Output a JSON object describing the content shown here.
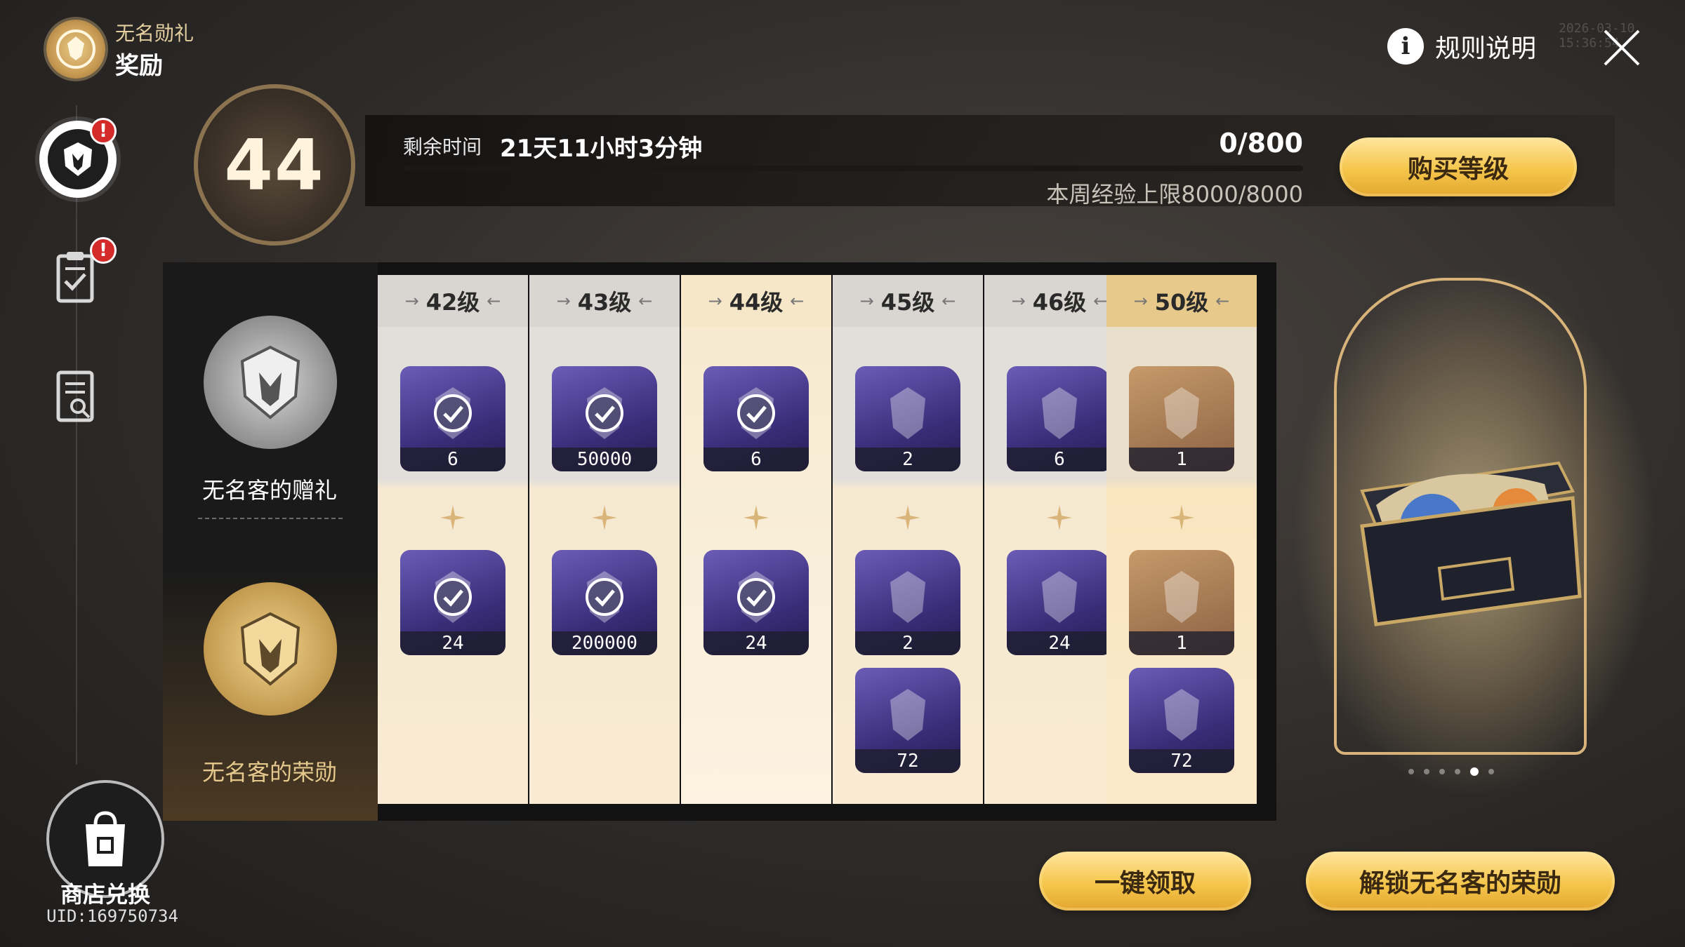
{
  "header": {
    "subtitle": "无名勋礼",
    "title": "奖励",
    "rules_label": "规则说明",
    "timestamp": "2026-03-10 15:36:54"
  },
  "sidebar": {
    "items": [
      {
        "name": "rewards",
        "alert": "!"
      },
      {
        "name": "missions",
        "alert": "!"
      },
      {
        "name": "records"
      }
    ],
    "shop_label": "商店兑换",
    "uid": "UID:169750734"
  },
  "level": {
    "current": "44",
    "time_label": "剩余时间",
    "time_value": "21天11小时3分钟",
    "exp": "0/800",
    "exp_progress": 0,
    "weekly_limit": "本周经验上限8000/8000",
    "buy_label": "购买等级"
  },
  "tiers": {
    "free": "无名客的赠礼",
    "paid": "无名客的荣勋"
  },
  "columns": [
    {
      "label": "42级",
      "free": [
        {
          "qty": "6",
          "claimed": true
        }
      ],
      "paid": [
        {
          "qty": "24",
          "claimed": true
        }
      ]
    },
    {
      "label": "43级",
      "free": [
        {
          "qty": "50000",
          "claimed": true
        }
      ],
      "paid": [
        {
          "qty": "200000",
          "claimed": true
        }
      ]
    },
    {
      "label": "44级",
      "free": [
        {
          "qty": "6",
          "claimed": true
        }
      ],
      "paid": [
        {
          "qty": "24",
          "claimed": true
        }
      ]
    },
    {
      "label": "45级",
      "free": [
        {
          "qty": "2",
          "claimed": false
        }
      ],
      "paid": [
        {
          "qty": "2",
          "claimed": false
        },
        {
          "qty": "72",
          "claimed": false
        }
      ]
    },
    {
      "label": "46级",
      "free": [
        {
          "qty": "6",
          "claimed": false
        }
      ],
      "paid": [
        {
          "qty": "24",
          "claimed": false
        }
      ]
    },
    {
      "label": "50级",
      "free": [
        {
          "qty": "1",
          "claimed": false
        }
      ],
      "paid": [
        {
          "qty": "1",
          "claimed": false
        },
        {
          "qty": "72",
          "claimed": false
        }
      ]
    }
  ],
  "track_alert": "!",
  "buttons": {
    "claim_all": "一键领取",
    "unlock": "解锁无名客的荣勋"
  },
  "carousel": {
    "count": 6,
    "active": 4
  }
}
